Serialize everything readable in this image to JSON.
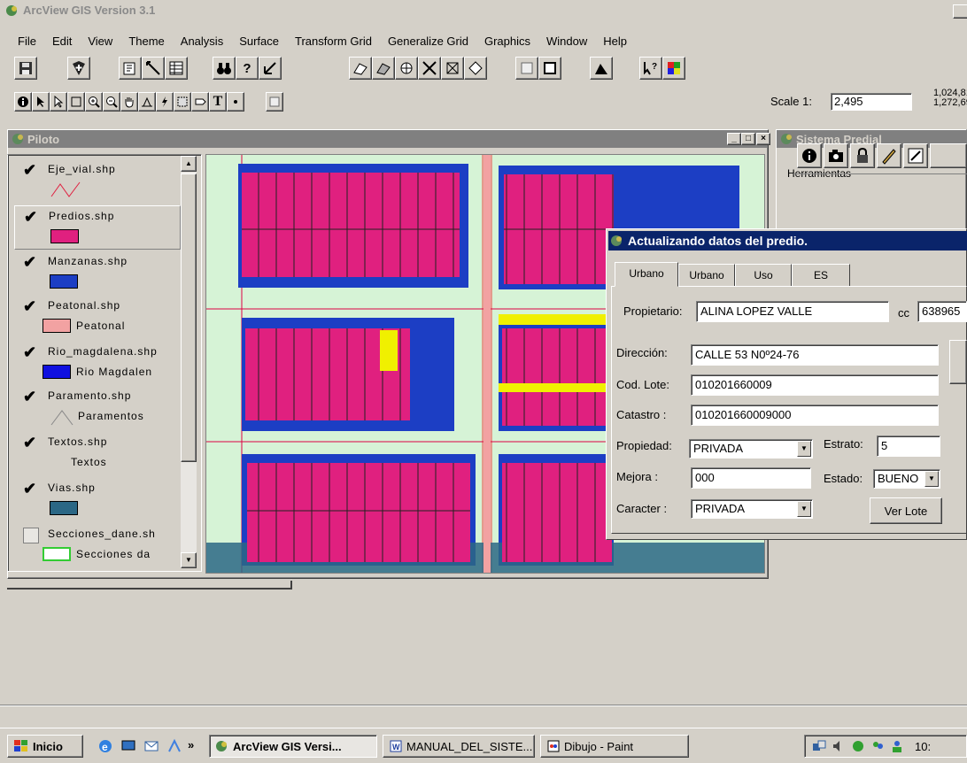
{
  "app": {
    "title": "ArcView GIS Version 3.1"
  },
  "menu": [
    "File",
    "Edit",
    "View",
    "Theme",
    "Analysis",
    "Surface",
    "Transform Grid",
    "Generalize Grid",
    "Graphics",
    "Window",
    "Help"
  ],
  "toolbar": {
    "scale_label": "Scale 1:",
    "scale_value": "2,495",
    "coord_x": "1,024,81",
    "coord_y": "1,272,69"
  },
  "piloto": {
    "title": "Piloto",
    "layers": [
      {
        "name": "Eje_vial.shp",
        "checked": true
      },
      {
        "name": "Predios.shp",
        "checked": true,
        "color": "#e0207f"
      },
      {
        "name": "Manzanas.shp",
        "checked": true,
        "color": "#1c3ec4"
      },
      {
        "name": "Peatonal.shp",
        "checked": true,
        "legend": "Peatonal",
        "color": "#f2a2a2"
      },
      {
        "name": "Rio_magdalena.shp",
        "checked": true,
        "legend": "Rio Magdalen",
        "color": "#1010e0"
      },
      {
        "name": "Paramento.shp",
        "checked": true,
        "legend": "Paramentos"
      },
      {
        "name": "Textos.shp",
        "checked": true,
        "legend": "Textos"
      },
      {
        "name": "Vias.shp",
        "checked": true,
        "color": "#2b6785"
      },
      {
        "name": "Secciones_dane.sh",
        "checked": false,
        "legend": "Secciones da",
        "color": "#33cc33"
      }
    ]
  },
  "sistema": {
    "title": "Sistema Predial",
    "herramientas_label": "Herramientas"
  },
  "dialog": {
    "title": "Actualizando datos del predio.",
    "tabs": [
      "Urbano",
      "Urbano",
      "Uso",
      "ES"
    ],
    "propietario_label": "Propietario:",
    "propietario_value": "ALINA  LOPEZ VALLE",
    "cc_label": "cc",
    "cc_value": "638965",
    "direccion_label": "Dirección:",
    "direccion_value": "CALLE 53  N0º24-76",
    "cod_lote_label": "Cod. Lote:",
    "cod_lote_value": "010201660009",
    "catastro_label": "Catastro :",
    "catastro_value": "010201660009000",
    "propiedad_label": "Propiedad:",
    "propiedad_value": "PRIVADA",
    "estrato_label": "Estrato:",
    "estrato_value": "5",
    "mejora_label": "Mejora   :",
    "mejora_value": "000",
    "estado_label": "Estado:",
    "estado_value": "BUENO",
    "caracter_label": "Caracter :",
    "caracter_value": "PRIVADA",
    "ver_lote": "Ver Lote"
  },
  "taskbar": {
    "start": "Inicio",
    "chevron": "»",
    "tasks": [
      "ArcView GIS Versi...",
      "MANUAL_DEL_SISTE...",
      "Dibujo - Paint"
    ],
    "clock": "10:"
  }
}
